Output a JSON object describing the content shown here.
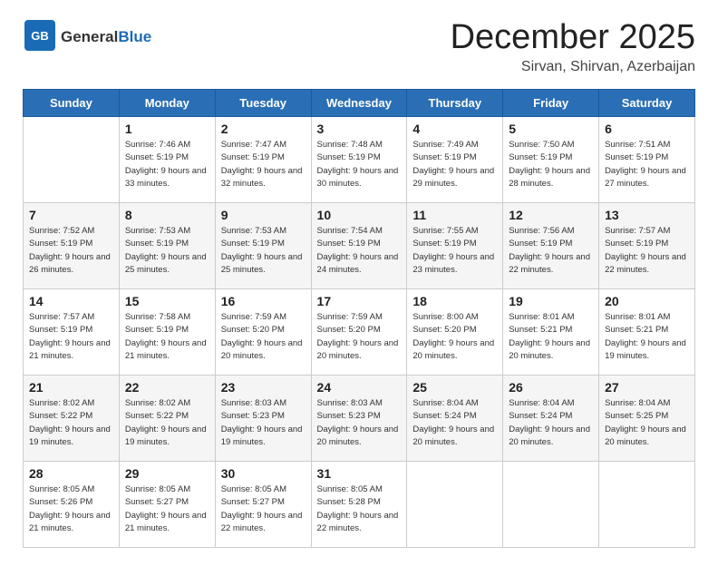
{
  "header": {
    "logo_general": "General",
    "logo_blue": "Blue",
    "month_title": "December 2025",
    "location": "Sirvan, Shirvan, Azerbaijan"
  },
  "calendar": {
    "days_of_week": [
      "Sunday",
      "Monday",
      "Tuesday",
      "Wednesday",
      "Thursday",
      "Friday",
      "Saturday"
    ],
    "weeks": [
      [
        {
          "day": "",
          "sunrise": "",
          "sunset": "",
          "daylight": ""
        },
        {
          "day": "1",
          "sunrise": "Sunrise: 7:46 AM",
          "sunset": "Sunset: 5:19 PM",
          "daylight": "Daylight: 9 hours and 33 minutes."
        },
        {
          "day": "2",
          "sunrise": "Sunrise: 7:47 AM",
          "sunset": "Sunset: 5:19 PM",
          "daylight": "Daylight: 9 hours and 32 minutes."
        },
        {
          "day": "3",
          "sunrise": "Sunrise: 7:48 AM",
          "sunset": "Sunset: 5:19 PM",
          "daylight": "Daylight: 9 hours and 30 minutes."
        },
        {
          "day": "4",
          "sunrise": "Sunrise: 7:49 AM",
          "sunset": "Sunset: 5:19 PM",
          "daylight": "Daylight: 9 hours and 29 minutes."
        },
        {
          "day": "5",
          "sunrise": "Sunrise: 7:50 AM",
          "sunset": "Sunset: 5:19 PM",
          "daylight": "Daylight: 9 hours and 28 minutes."
        },
        {
          "day": "6",
          "sunrise": "Sunrise: 7:51 AM",
          "sunset": "Sunset: 5:19 PM",
          "daylight": "Daylight: 9 hours and 27 minutes."
        }
      ],
      [
        {
          "day": "7",
          "sunrise": "Sunrise: 7:52 AM",
          "sunset": "Sunset: 5:19 PM",
          "daylight": "Daylight: 9 hours and 26 minutes."
        },
        {
          "day": "8",
          "sunrise": "Sunrise: 7:53 AM",
          "sunset": "Sunset: 5:19 PM",
          "daylight": "Daylight: 9 hours and 25 minutes."
        },
        {
          "day": "9",
          "sunrise": "Sunrise: 7:53 AM",
          "sunset": "Sunset: 5:19 PM",
          "daylight": "Daylight: 9 hours and 25 minutes."
        },
        {
          "day": "10",
          "sunrise": "Sunrise: 7:54 AM",
          "sunset": "Sunset: 5:19 PM",
          "daylight": "Daylight: 9 hours and 24 minutes."
        },
        {
          "day": "11",
          "sunrise": "Sunrise: 7:55 AM",
          "sunset": "Sunset: 5:19 PM",
          "daylight": "Daylight: 9 hours and 23 minutes."
        },
        {
          "day": "12",
          "sunrise": "Sunrise: 7:56 AM",
          "sunset": "Sunset: 5:19 PM",
          "daylight": "Daylight: 9 hours and 22 minutes."
        },
        {
          "day": "13",
          "sunrise": "Sunrise: 7:57 AM",
          "sunset": "Sunset: 5:19 PM",
          "daylight": "Daylight: 9 hours and 22 minutes."
        }
      ],
      [
        {
          "day": "14",
          "sunrise": "Sunrise: 7:57 AM",
          "sunset": "Sunset: 5:19 PM",
          "daylight": "Daylight: 9 hours and 21 minutes."
        },
        {
          "day": "15",
          "sunrise": "Sunrise: 7:58 AM",
          "sunset": "Sunset: 5:19 PM",
          "daylight": "Daylight: 9 hours and 21 minutes."
        },
        {
          "day": "16",
          "sunrise": "Sunrise: 7:59 AM",
          "sunset": "Sunset: 5:20 PM",
          "daylight": "Daylight: 9 hours and 20 minutes."
        },
        {
          "day": "17",
          "sunrise": "Sunrise: 7:59 AM",
          "sunset": "Sunset: 5:20 PM",
          "daylight": "Daylight: 9 hours and 20 minutes."
        },
        {
          "day": "18",
          "sunrise": "Sunrise: 8:00 AM",
          "sunset": "Sunset: 5:20 PM",
          "daylight": "Daylight: 9 hours and 20 minutes."
        },
        {
          "day": "19",
          "sunrise": "Sunrise: 8:01 AM",
          "sunset": "Sunset: 5:21 PM",
          "daylight": "Daylight: 9 hours and 20 minutes."
        },
        {
          "day": "20",
          "sunrise": "Sunrise: 8:01 AM",
          "sunset": "Sunset: 5:21 PM",
          "daylight": "Daylight: 9 hours and 19 minutes."
        }
      ],
      [
        {
          "day": "21",
          "sunrise": "Sunrise: 8:02 AM",
          "sunset": "Sunset: 5:22 PM",
          "daylight": "Daylight: 9 hours and 19 minutes."
        },
        {
          "day": "22",
          "sunrise": "Sunrise: 8:02 AM",
          "sunset": "Sunset: 5:22 PM",
          "daylight": "Daylight: 9 hours and 19 minutes."
        },
        {
          "day": "23",
          "sunrise": "Sunrise: 8:03 AM",
          "sunset": "Sunset: 5:23 PM",
          "daylight": "Daylight: 9 hours and 19 minutes."
        },
        {
          "day": "24",
          "sunrise": "Sunrise: 8:03 AM",
          "sunset": "Sunset: 5:23 PM",
          "daylight": "Daylight: 9 hours and 20 minutes."
        },
        {
          "day": "25",
          "sunrise": "Sunrise: 8:04 AM",
          "sunset": "Sunset: 5:24 PM",
          "daylight": "Daylight: 9 hours and 20 minutes."
        },
        {
          "day": "26",
          "sunrise": "Sunrise: 8:04 AM",
          "sunset": "Sunset: 5:24 PM",
          "daylight": "Daylight: 9 hours and 20 minutes."
        },
        {
          "day": "27",
          "sunrise": "Sunrise: 8:04 AM",
          "sunset": "Sunset: 5:25 PM",
          "daylight": "Daylight: 9 hours and 20 minutes."
        }
      ],
      [
        {
          "day": "28",
          "sunrise": "Sunrise: 8:05 AM",
          "sunset": "Sunset: 5:26 PM",
          "daylight": "Daylight: 9 hours and 21 minutes."
        },
        {
          "day": "29",
          "sunrise": "Sunrise: 8:05 AM",
          "sunset": "Sunset: 5:27 PM",
          "daylight": "Daylight: 9 hours and 21 minutes."
        },
        {
          "day": "30",
          "sunrise": "Sunrise: 8:05 AM",
          "sunset": "Sunset: 5:27 PM",
          "daylight": "Daylight: 9 hours and 22 minutes."
        },
        {
          "day": "31",
          "sunrise": "Sunrise: 8:05 AM",
          "sunset": "Sunset: 5:28 PM",
          "daylight": "Daylight: 9 hours and 22 minutes."
        },
        {
          "day": "",
          "sunrise": "",
          "sunset": "",
          "daylight": ""
        },
        {
          "day": "",
          "sunrise": "",
          "sunset": "",
          "daylight": ""
        },
        {
          "day": "",
          "sunrise": "",
          "sunset": "",
          "daylight": ""
        }
      ]
    ]
  }
}
